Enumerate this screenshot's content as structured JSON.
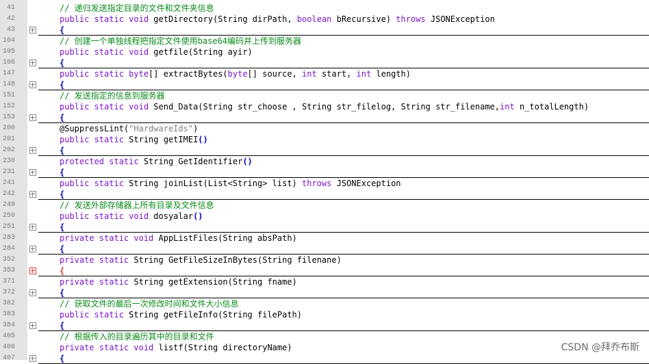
{
  "editor": {
    "lines": [
      {
        "num": "41",
        "fold": "",
        "sep": false,
        "tokens": [
          {
            "t": "// 递归发送指定目录的文件和文件夹信息",
            "c": "com"
          }
        ]
      },
      {
        "num": "42",
        "fold": "",
        "sep": false,
        "tokens": [
          {
            "t": "public static void",
            "c": "kw"
          },
          {
            "t": " getDirectory(String dirPath, ",
            "c": "pl"
          },
          {
            "t": "boolean",
            "c": "kw"
          },
          {
            "t": " bRecursive) ",
            "c": "pl"
          },
          {
            "t": "throws",
            "c": "kw"
          },
          {
            "t": " JSONException",
            "c": "pl"
          }
        ]
      },
      {
        "num": "43",
        "fold": "plus",
        "sep": true,
        "tokens": [
          {
            "t": "{",
            "c": "brace"
          }
        ]
      },
      {
        "num": "104",
        "fold": "",
        "sep": false,
        "tokens": [
          {
            "t": "// 创建一个单独线程把指定文件使用base64编码并上传到服务器",
            "c": "com"
          }
        ]
      },
      {
        "num": "105",
        "fold": "",
        "sep": false,
        "tokens": [
          {
            "t": "public static void",
            "c": "kw"
          },
          {
            "t": " getfile(String ayir)",
            "c": "pl"
          }
        ]
      },
      {
        "num": "106",
        "fold": "plus",
        "sep": true,
        "tokens": [
          {
            "t": "{",
            "c": "brace"
          }
        ]
      },
      {
        "num": "147",
        "fold": "",
        "sep": false,
        "tokens": [
          {
            "t": "public static byte",
            "c": "kw"
          },
          {
            "t": "[] extractBytes(",
            "c": "pl"
          },
          {
            "t": "byte",
            "c": "kw"
          },
          {
            "t": "[] source, ",
            "c": "pl"
          },
          {
            "t": "int",
            "c": "kw"
          },
          {
            "t": " start, ",
            "c": "pl"
          },
          {
            "t": "int",
            "c": "kw"
          },
          {
            "t": " length)",
            "c": "pl"
          }
        ]
      },
      {
        "num": "148",
        "fold": "plus",
        "sep": true,
        "tokens": [
          {
            "t": "{",
            "c": "brace"
          }
        ]
      },
      {
        "num": "151",
        "fold": "",
        "sep": false,
        "tokens": [
          {
            "t": "// 发送指定的信息到服务器",
            "c": "com"
          }
        ]
      },
      {
        "num": "152",
        "fold": "",
        "sep": false,
        "tokens": [
          {
            "t": "public static void",
            "c": "kw"
          },
          {
            "t": " Send_Data(String str_choose , String str_filelog, String str_filename,",
            "c": "pl"
          },
          {
            "t": "int",
            "c": "kw"
          },
          {
            "t": " n_totalLength)",
            "c": "pl"
          }
        ]
      },
      {
        "num": "153",
        "fold": "plus",
        "sep": true,
        "tokens": [
          {
            "t": "{",
            "c": "brace"
          }
        ]
      },
      {
        "num": "200",
        "fold": "",
        "sep": false,
        "tokens": [
          {
            "t": "@SuppressLint(",
            "c": "pl"
          },
          {
            "t": "\"HardwareIds\"",
            "c": "str"
          },
          {
            "t": ")",
            "c": "pl"
          }
        ]
      },
      {
        "num": "201",
        "fold": "",
        "sep": false,
        "tokens": [
          {
            "t": "public static",
            "c": "kw"
          },
          {
            "t": " String getIMEI",
            "c": "pl"
          },
          {
            "t": "()",
            "c": "brace"
          }
        ]
      },
      {
        "num": "202",
        "fold": "plus",
        "sep": true,
        "tokens": [
          {
            "t": "{",
            "c": "brace"
          }
        ]
      },
      {
        "num": "230",
        "fold": "",
        "sep": false,
        "tokens": [
          {
            "t": "protected static",
            "c": "kw"
          },
          {
            "t": " String GetIdentifier",
            "c": "pl"
          },
          {
            "t": "()",
            "c": "brace"
          }
        ]
      },
      {
        "num": "231",
        "fold": "plus",
        "sep": true,
        "tokens": [
          {
            "t": "{",
            "c": "brace"
          }
        ]
      },
      {
        "num": "241",
        "fold": "",
        "sep": false,
        "tokens": [
          {
            "t": "public static",
            "c": "kw"
          },
          {
            "t": " String joinList(List<String> list) ",
            "c": "pl"
          },
          {
            "t": "throws",
            "c": "kw"
          },
          {
            "t": " JSONException",
            "c": "pl"
          }
        ]
      },
      {
        "num": "242",
        "fold": "plus",
        "sep": true,
        "tokens": [
          {
            "t": "{",
            "c": "brace"
          }
        ]
      },
      {
        "num": "249",
        "fold": "",
        "sep": false,
        "tokens": [
          {
            "t": "// 发送外部存储器上所有目录及文件信息",
            "c": "com"
          }
        ]
      },
      {
        "num": "250",
        "fold": "",
        "sep": false,
        "tokens": [
          {
            "t": "public static void",
            "c": "kw"
          },
          {
            "t": " dosyalar",
            "c": "pl"
          },
          {
            "t": "()",
            "c": "brace"
          }
        ]
      },
      {
        "num": "251",
        "fold": "plus",
        "sep": true,
        "tokens": [
          {
            "t": "{",
            "c": "brace"
          }
        ]
      },
      {
        "num": "283",
        "fold": "",
        "sep": false,
        "tokens": [
          {
            "t": "private static void",
            "c": "kw"
          },
          {
            "t": " AppListFiles(String absPath)",
            "c": "pl"
          }
        ]
      },
      {
        "num": "284",
        "fold": "plus",
        "sep": true,
        "tokens": [
          {
            "t": "{",
            "c": "brace"
          }
        ]
      },
      {
        "num": "352",
        "fold": "",
        "sep": false,
        "tokens": [
          {
            "t": "private static",
            "c": "kw"
          },
          {
            "t": " String GetFileSizeInBytes(String filenane)",
            "c": "pl"
          }
        ]
      },
      {
        "num": "353",
        "fold": "red",
        "sep": true,
        "tokens": [
          {
            "t": "{",
            "c": "brace red"
          }
        ]
      },
      {
        "num": "371",
        "fold": "",
        "sep": false,
        "tokens": [
          {
            "t": "private static",
            "c": "kw"
          },
          {
            "t": " String getExtension(String fname)",
            "c": "pl"
          }
        ]
      },
      {
        "num": "372",
        "fold": "plus",
        "sep": true,
        "tokens": [
          {
            "t": "{",
            "c": "brace"
          }
        ]
      },
      {
        "num": "382",
        "fold": "",
        "sep": false,
        "tokens": [
          {
            "t": "// 获取文件的最后一次修改时间和文件大小信息",
            "c": "com"
          }
        ]
      },
      {
        "num": "383",
        "fold": "",
        "sep": false,
        "tokens": [
          {
            "t": "public static",
            "c": "kw"
          },
          {
            "t": " String getFileInfo(String filePath)",
            "c": "pl"
          }
        ]
      },
      {
        "num": "384",
        "fold": "plus",
        "sep": true,
        "tokens": [
          {
            "t": "{",
            "c": "brace"
          }
        ]
      },
      {
        "num": "405",
        "fold": "",
        "sep": false,
        "tokens": [
          {
            "t": "// 根据传入的目录遍历其中的目录和文件",
            "c": "com"
          }
        ]
      },
      {
        "num": "406",
        "fold": "",
        "sep": false,
        "tokens": [
          {
            "t": "private static void",
            "c": "kw"
          },
          {
            "t": " listf(String directoryName)",
            "c": "pl"
          }
        ]
      },
      {
        "num": "407",
        "fold": "plus",
        "sep": true,
        "tokens": [
          {
            "t": "{",
            "c": "brace"
          }
        ]
      }
    ]
  },
  "watermark": "CSDN @拜乔布斯"
}
